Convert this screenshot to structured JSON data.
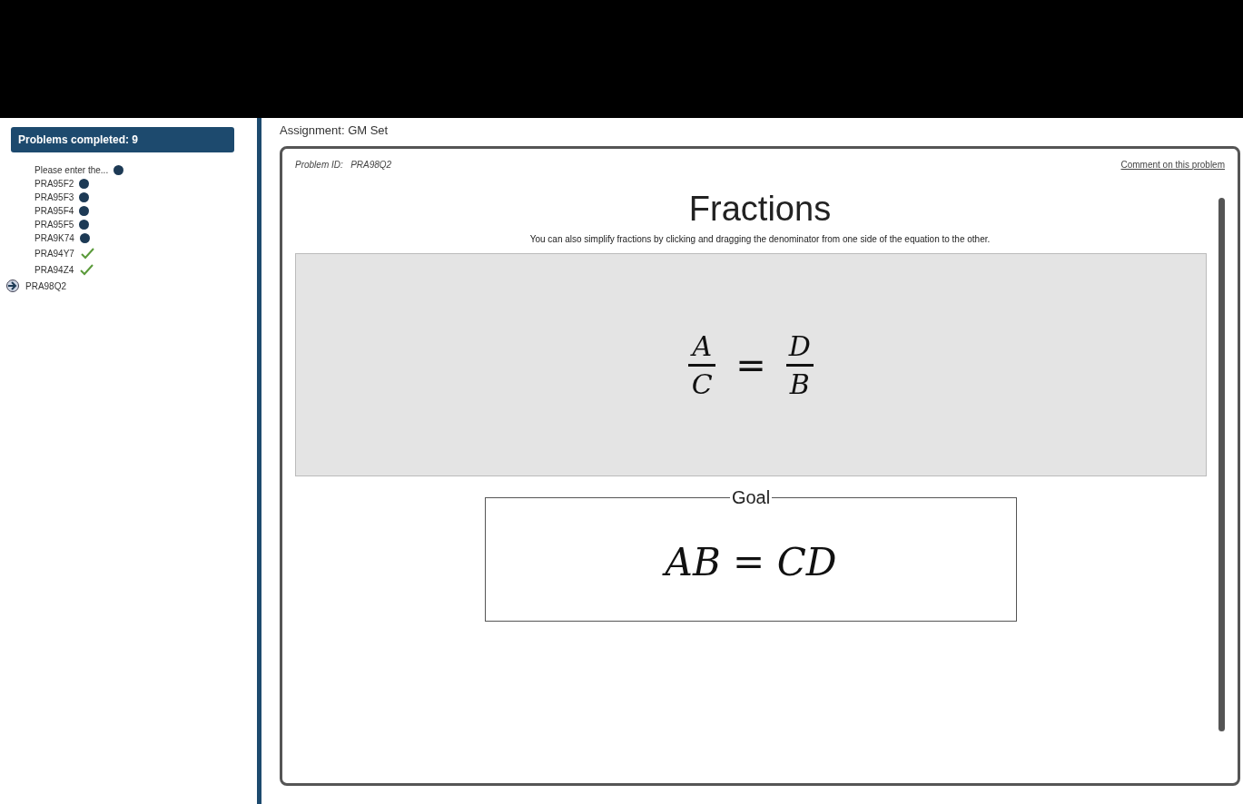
{
  "sidebar": {
    "header": "Problems completed: 9",
    "items": [
      {
        "label": "Please enter the...",
        "kind": "dot"
      },
      {
        "label": "PRA95F2",
        "kind": "dot"
      },
      {
        "label": "PRA95F3",
        "kind": "dot"
      },
      {
        "label": "PRA95F4",
        "kind": "dot"
      },
      {
        "label": "PRA95F5",
        "kind": "dot"
      },
      {
        "label": "PRA9K74",
        "kind": "dot"
      },
      {
        "label": "PRA94Y7",
        "kind": "check"
      },
      {
        "label": "PRA94Z4",
        "kind": "check"
      },
      {
        "label": "PRA98Q2",
        "kind": "current"
      }
    ]
  },
  "assignment": "Assignment: GM Set",
  "problem": {
    "id_label": "Problem ID:",
    "id": "PRA98Q2",
    "comment_link": "Comment on this problem",
    "title": "Fractions",
    "instruction": "You can also simplify fractions by clicking and dragging the denominator from one side of the equation to the other.",
    "equation": {
      "left": {
        "numerator": "A",
        "denominator": "C"
      },
      "operator": "=",
      "right": {
        "numerator": "D",
        "denominator": "B"
      }
    },
    "goal": {
      "legend": "Goal",
      "expression": "AB = CD"
    }
  }
}
